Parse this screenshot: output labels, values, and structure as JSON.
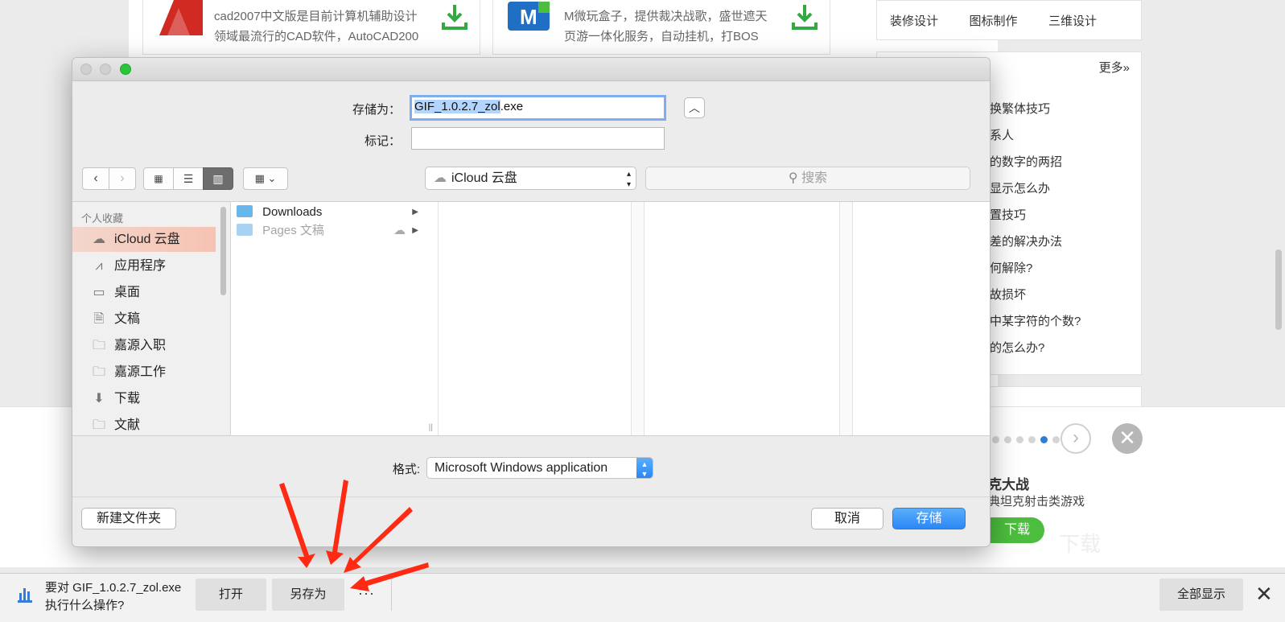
{
  "background_page": {
    "card1": {
      "desc": [
        "cad2007中文版是目前计算机辅助设计",
        "领域最流行的CAD软件，AutoCAD200"
      ]
    },
    "card2": {
      "desc": [
        "M微玩盒子，提供裁决战歌，盛世遮天",
        "页游一体化服务，自动挂机，打BOS"
      ]
    },
    "tags": [
      "装修设计",
      "图标制作",
      "三维设计"
    ],
    "more_label": "更多»",
    "tips": [
      "换繁体技巧",
      "系人",
      "的数字的两招",
      "显示怎么办",
      "置技巧",
      "差的解决办法",
      "何解除?",
      "故损坏",
      "中某字符的个数?",
      "的怎么办?"
    ],
    "ad": {
      "title": "克大战",
      "subtitle": "典坦克射击类游戏",
      "download_label": "下载",
      "close_glyph": "✕",
      "next_glyph": "›"
    }
  },
  "dialog": {
    "save_as_label": "存储为：",
    "filename": "GIF_1.0.2.7_zol.exe",
    "filename_selected": "GIF_1.0.2.7_zol",
    "filename_ext": ".exe",
    "tags_label": "标记：",
    "tags_value": "",
    "location": "iCloud 云盘",
    "search_placeholder": "搜索",
    "sidebar_heading": "个人收藏",
    "sidebar_items": [
      {
        "label": "iCloud 云盘",
        "icon": "cloud-icon",
        "selected": true
      },
      {
        "label": "应用程序",
        "icon": "applications-icon"
      },
      {
        "label": "桌面",
        "icon": "desktop-icon"
      },
      {
        "label": "文稿",
        "icon": "documents-icon"
      },
      {
        "label": "嘉源入职",
        "icon": "folder-icon"
      },
      {
        "label": "嘉源工作",
        "icon": "folder-icon"
      },
      {
        "label": "下载",
        "icon": "downloads-icon"
      },
      {
        "label": "文献",
        "icon": "folder-icon"
      }
    ],
    "files": [
      {
        "name": "Downloads",
        "dim": false
      },
      {
        "name": "Pages 文稿",
        "dim": true
      }
    ],
    "format_label": "格式:",
    "format_value": "Microsoft Windows application",
    "new_folder_label": "新建文件夹",
    "cancel_label": "取消",
    "save_label": "存储"
  },
  "download_bar": {
    "prompt_line1": "要对 GIF_1.0.2.7_zol.exe",
    "prompt_line2": "执行什么操作?",
    "open_label": "打开",
    "save_as_label": "另存为",
    "more_label": "···",
    "show_all_label": "全部显示",
    "close_glyph": "✕"
  },
  "colors": {
    "accent_blue": "#2b87f5",
    "selection_salmon": "#f6c3b2",
    "annotation_red": "#ff2a14",
    "ad_green": "#4cbd3e"
  }
}
